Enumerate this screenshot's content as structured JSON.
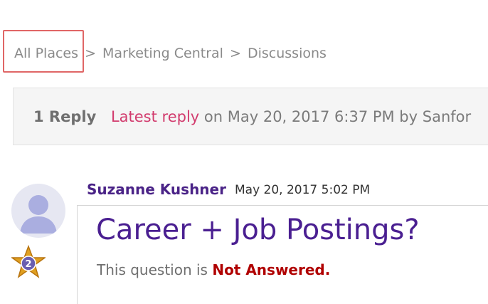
{
  "breadcrumb": {
    "items": [
      "All Places",
      "Marketing Central",
      "Discussions"
    ],
    "separator": ">"
  },
  "reply_bar": {
    "count": "1 Reply",
    "latest_label": "Latest reply",
    "rest": "on May 20, 2017 6:37 PM by Sanfor"
  },
  "post": {
    "author": "Suzanne Kushner",
    "date": "May 20, 2017 5:02 PM",
    "title": "Career + Job Postings?",
    "status_prefix": "This question is",
    "status_value": "Not Answered.",
    "badge_level": "2"
  },
  "icons": {
    "avatar": "user-avatar-icon",
    "badge": "star-badge-icon"
  },
  "colors": {
    "accent_purple": "#4a1f91",
    "link_pink": "#d23c6e",
    "status_red": "#b00000",
    "highlight_red": "#e06666"
  }
}
